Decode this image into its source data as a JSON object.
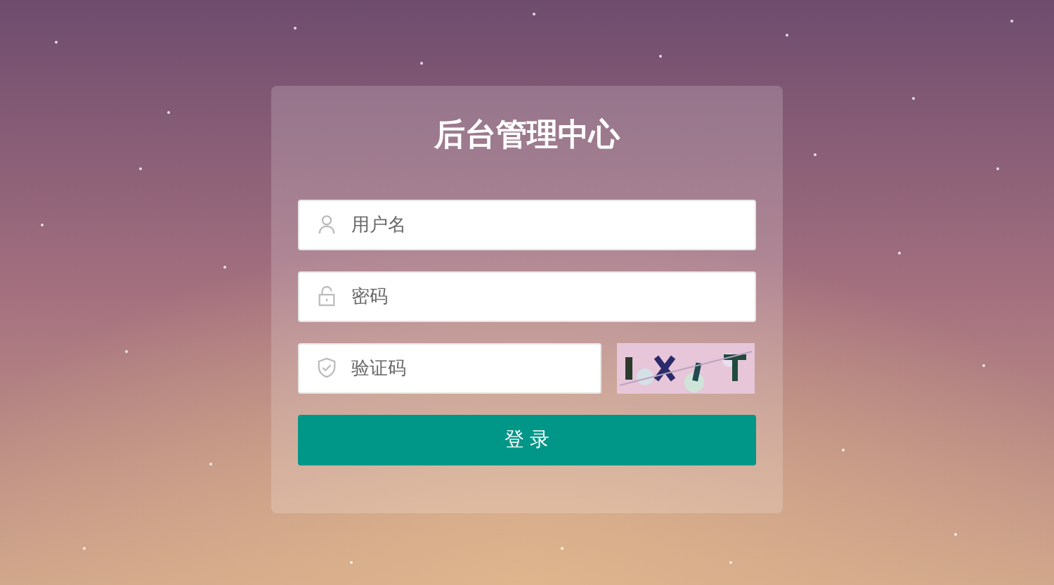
{
  "title": "后台管理中心",
  "fields": [
    {
      "kind": "user",
      "placeholder": "用户名"
    },
    {
      "kind": "lock",
      "placeholder": "密码"
    },
    {
      "kind": "shield",
      "placeholder": "验证码"
    }
  ],
  "button": "登 录"
}
